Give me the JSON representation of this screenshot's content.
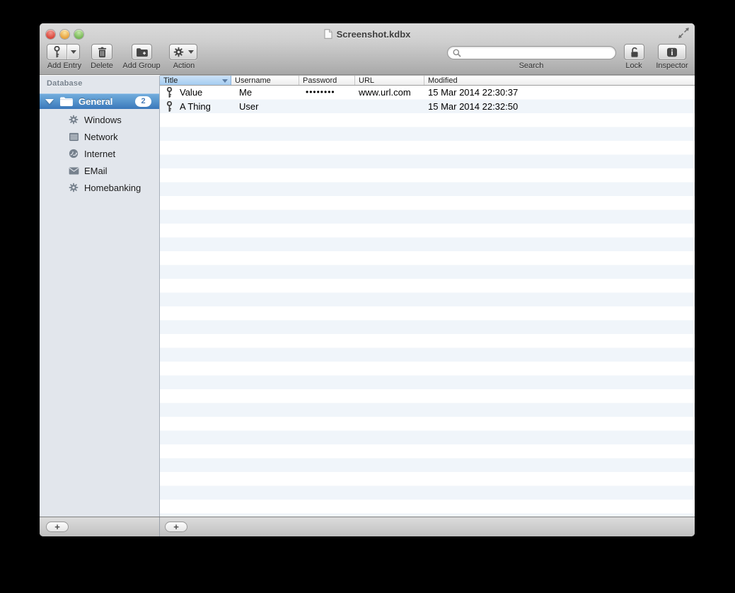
{
  "window": {
    "title": "Screenshot.kdbx"
  },
  "toolbar": {
    "add_entry_label": "Add Entry",
    "delete_label": "Delete",
    "add_group_label": "Add Group",
    "action_label": "Action",
    "search_label": "Search",
    "search_value": "",
    "lock_label": "Lock",
    "inspector_label": "Inspector"
  },
  "sidebar": {
    "header": "Database",
    "group": {
      "label": "General",
      "badge": "2"
    },
    "items": [
      {
        "label": "Windows",
        "icon": "gear-icon"
      },
      {
        "label": "Network",
        "icon": "server-icon"
      },
      {
        "label": "Internet",
        "icon": "globe-icon"
      },
      {
        "label": "EMail",
        "icon": "envelope-icon"
      },
      {
        "label": "Homebanking",
        "icon": "gear-icon"
      }
    ]
  },
  "table": {
    "columns": [
      "Title",
      "Username",
      "Password",
      "URL",
      "Modified"
    ],
    "sort_column": "Title",
    "rows": [
      {
        "title": "Value",
        "username": "Me",
        "password": "••••••••",
        "url": "www.url.com",
        "modified": "15 Mar 2014 22:30:37"
      },
      {
        "title": "A Thing",
        "username": "User",
        "password": "",
        "url": "",
        "modified": "15 Mar 2014 22:32:50"
      }
    ]
  },
  "footer": {
    "add_group_plus": "+",
    "add_entry_plus": "+"
  },
  "colors": {
    "selection_blue": "#4a84c2",
    "header_sort_blue": "#a4ccf0",
    "row_stripe": "#f0f5fa",
    "sidebar_bg": "#e2e6ec",
    "toolbar_gradient_top": "#dbdbdb",
    "toolbar_gradient_bottom": "#a8a8a8"
  }
}
